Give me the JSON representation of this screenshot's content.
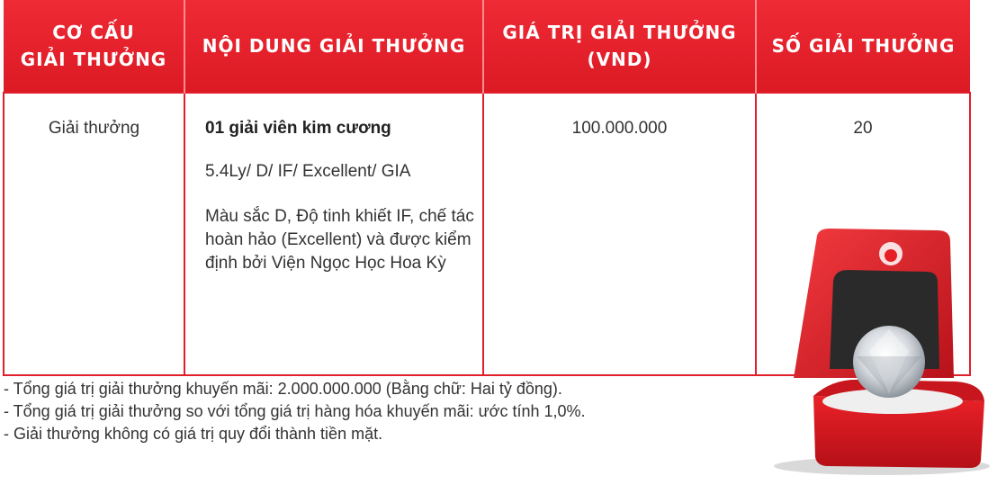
{
  "table": {
    "headers": [
      "CƠ CẤU\nGIẢI THƯỞNG",
      "NỘI DUNG GIẢI THƯỞNG",
      "GIÁ TRỊ GIẢI THƯỞNG\n(VND)",
      "SỐ GIẢI THƯỞNG"
    ],
    "row": {
      "category": "Giải thưởng",
      "prize_name": "01 giải viên kim cương",
      "spec": "5.4Ly/ D/ IF/ Excellent/ GIA",
      "description": "Màu sắc D, Độ tinh khiết IF, chế tác hoàn hảo (Excellent) và được kiểm định bởi Viện Ngọc Học Hoa Kỳ",
      "value": "100.000.000",
      "count": "20"
    }
  },
  "notes": [
    "- Tổng giá trị giải thưởng khuyến mãi: 2.000.000.000 (Bằng chữ: Hai tỷ đồng).",
    "- Tổng giá trị giải thưởng so với tổng giá trị hàng hóa khuyến mãi: ước tính 1,0%.",
    "- Giải thưởng không có giá trị quy đổi thành tiền mặt."
  ],
  "colors": {
    "header_red": "#e3202b",
    "border_red": "#e01f2a",
    "box_red": "#e61e25"
  }
}
